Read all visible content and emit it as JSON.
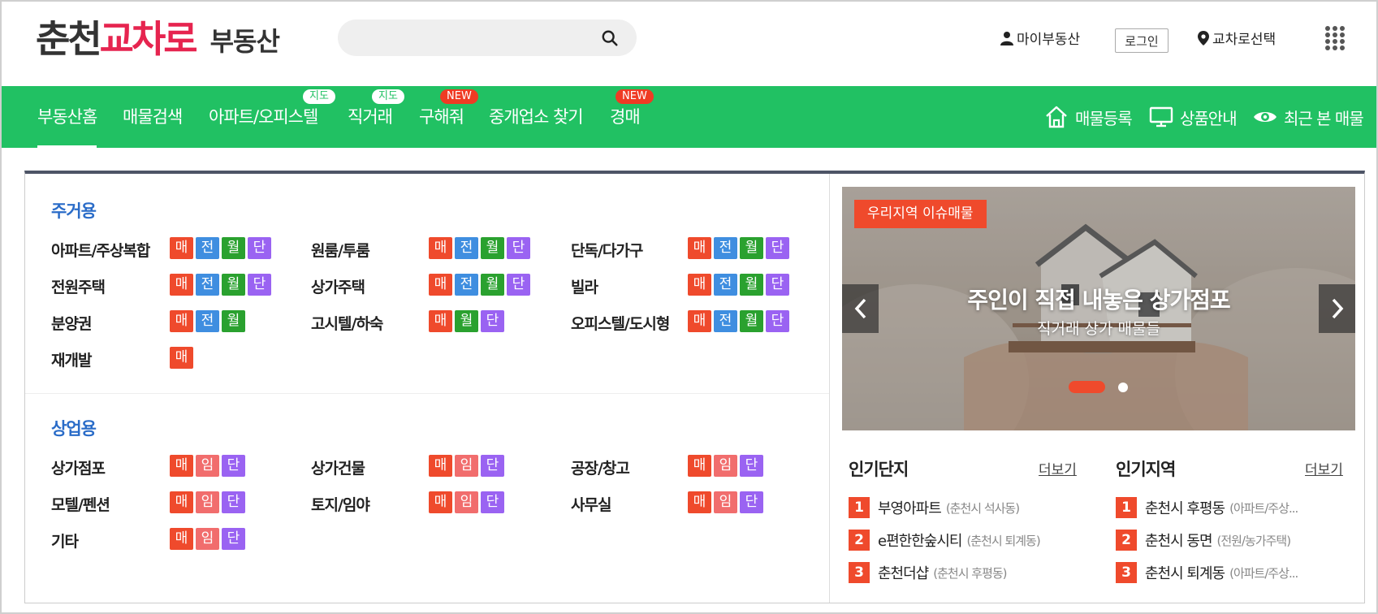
{
  "header": {
    "logo": {
      "part1": "춘천",
      "part2": "교차로",
      "part3": "부동산"
    },
    "search_placeholder": "",
    "my_page": "마이부동산",
    "login": "로그인",
    "region_select": "교차로선택"
  },
  "gnb": {
    "items": [
      {
        "label": "부동산홈"
      },
      {
        "label": "매물검색"
      },
      {
        "label": "아파트/오피스텔",
        "badge": "지도"
      },
      {
        "label": "직거래",
        "badge": "지도"
      },
      {
        "label": "구해줘",
        "badge": "NEW"
      },
      {
        "label": "중개업소 찾기"
      },
      {
        "label": "경매",
        "badge": "NEW"
      }
    ],
    "right": {
      "register": "매물등록",
      "products": "상품안내",
      "recent": "최근 본 매물"
    }
  },
  "residential": {
    "title": "주거용",
    "items": [
      {
        "name": "아파트/주상복합",
        "tags": [
          "매",
          "전",
          "월",
          "단"
        ]
      },
      {
        "name": "원룸/투룸",
        "tags": [
          "매",
          "전",
          "월",
          "단"
        ]
      },
      {
        "name": "단독/다가구",
        "tags": [
          "매",
          "전",
          "월",
          "단"
        ]
      },
      {
        "name": "전원주택",
        "tags": [
          "매",
          "전",
          "월",
          "단"
        ]
      },
      {
        "name": "상가주택",
        "tags": [
          "매",
          "전",
          "월",
          "단"
        ]
      },
      {
        "name": "빌라",
        "tags": [
          "매",
          "전",
          "월",
          "단"
        ]
      },
      {
        "name": "분양권",
        "tags": [
          "매",
          "전",
          "월"
        ]
      },
      {
        "name": "고시텔/하숙",
        "tags": [
          "매",
          "월",
          "단"
        ]
      },
      {
        "name": "오피스텔/도시형",
        "tags": [
          "매",
          "전",
          "월",
          "단"
        ]
      },
      {
        "name": "재개발",
        "tags": [
          "매"
        ]
      }
    ]
  },
  "commercial": {
    "title": "상업용",
    "items": [
      {
        "name": "상가점포",
        "tags": [
          "매",
          "임",
          "단"
        ]
      },
      {
        "name": "상가건물",
        "tags": [
          "매",
          "임",
          "단"
        ]
      },
      {
        "name": "공장/창고",
        "tags": [
          "매",
          "임",
          "단"
        ]
      },
      {
        "name": "모텔/펜션",
        "tags": [
          "매",
          "임",
          "단"
        ]
      },
      {
        "name": "토지/임야",
        "tags": [
          "매",
          "임",
          "단"
        ]
      },
      {
        "name": "사무실",
        "tags": [
          "매",
          "임",
          "단"
        ]
      },
      {
        "name": "기타",
        "tags": [
          "매",
          "임",
          "단"
        ]
      }
    ]
  },
  "tag_colors": {
    "매": "#ef4a2c",
    "전": "#3f8ee0",
    "월": "#2aa12f",
    "단": "#9a63f2",
    "임": "#f16d6d"
  },
  "banner": {
    "tag": "우리지역 이슈매물",
    "title": "주인이 직접 내놓은 상가점포",
    "subtitle": "직거래 상가 매물들"
  },
  "popular_complex": {
    "title": "인기단지",
    "more": "더보기",
    "items": [
      {
        "rank": "1",
        "name": "부영아파트",
        "sub": "(춘천시 석사동)"
      },
      {
        "rank": "2",
        "name": "e편한한숲시티",
        "sub": "(춘천시 퇴계동)"
      },
      {
        "rank": "3",
        "name": "춘천더샵",
        "sub": "(춘천시 후평동)"
      }
    ]
  },
  "popular_region": {
    "title": "인기지역",
    "more": "더보기",
    "items": [
      {
        "rank": "1",
        "name": "춘천시 후평동",
        "sub": "(아파트/주상..."
      },
      {
        "rank": "2",
        "name": "춘천시 동면",
        "sub": "(전원/농가주택)"
      },
      {
        "rank": "3",
        "name": "춘천시 퇴계동",
        "sub": "(아파트/주상..."
      }
    ]
  },
  "colors": {
    "brand_green": "#21c163",
    "logo_pink": "#e6244f",
    "accent_orange": "#ef4a2c",
    "section_blue": "#2a6cc8"
  }
}
